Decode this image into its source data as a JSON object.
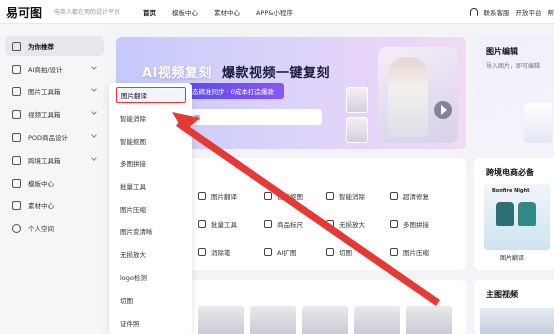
{
  "header": {
    "logo": "易可图",
    "slogan": "电商人都在用的设计平台",
    "nav": [
      "首页",
      "模板中心",
      "素材中心",
      "APP&小程序"
    ],
    "right": [
      "联系客服",
      "开放平台",
      "帮"
    ]
  },
  "sidebar": {
    "items": [
      {
        "label": "为你推荐",
        "icon": "home-icon",
        "active": true,
        "has_chevron": false
      },
      {
        "label": "AI商拍/设计",
        "icon": "ai-icon",
        "active": false,
        "has_chevron": true
      },
      {
        "label": "图片工具箱",
        "icon": "image-icon",
        "active": false,
        "has_chevron": true
      },
      {
        "label": "视频工具箱",
        "icon": "video-icon",
        "active": false,
        "has_chevron": true
      },
      {
        "label": "POD商品设计",
        "icon": "pod-icon",
        "active": false,
        "has_chevron": true
      },
      {
        "label": "跨境工具箱",
        "icon": "crossborder-icon",
        "active": false,
        "has_chevron": true
      },
      {
        "label": "模板中心",
        "icon": "template-icon",
        "active": false,
        "has_chevron": false
      },
      {
        "label": "素材中心",
        "icon": "material-icon",
        "active": false,
        "has_chevron": false
      },
      {
        "label": "个人空间",
        "icon": "user-icon",
        "active": false,
        "has_chevron": false
      }
    ]
  },
  "dropdown": {
    "items": [
      "图片翻译",
      "智能消除",
      "智能抠图",
      "多图拼接",
      "批量工具",
      "图片压缩",
      "图片变清晰",
      "无损放大",
      "logo检测",
      "切图",
      "证件照"
    ],
    "selected_index": 0,
    "highlight_color": "#e53935"
  },
  "banner": {
    "title_part1": "AI视频复刻",
    "title_part2": "爆款视频一键复刻",
    "pill": "态精准同步 · 0成本打造爆款",
    "input_text": "图"
  },
  "tools": {
    "rows": [
      [
        "图片翻译",
        "智能抠图",
        "智能消除",
        "超清修复"
      ],
      [
        "批量工具",
        "商品标尺",
        "无损放大",
        "多图拼接"
      ],
      [
        "消除笔",
        "AI扩图",
        "切图",
        "图片压缩"
      ]
    ]
  },
  "right_cards": {
    "card1_title": "图片编辑",
    "card1_sub": "导入图片，即可编辑",
    "card2_title": "跨境电商必备",
    "card2_thumb_text": "Bonfire Night",
    "card2_caption": "图片翻译",
    "card3_title": "主图视频"
  },
  "colors": {
    "accent": "#5b49f0",
    "arrow": "#e53935",
    "sidebar_active": "#e7e8ee"
  }
}
